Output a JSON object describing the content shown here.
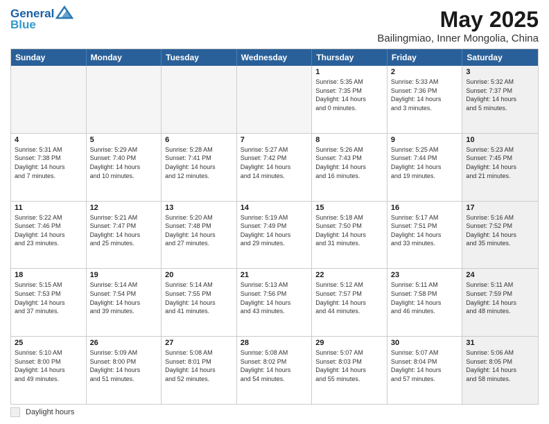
{
  "header": {
    "logo_general": "General",
    "logo_blue": "Blue",
    "title": "May 2025",
    "subtitle": "Bailingmiao, Inner Mongolia, China"
  },
  "calendar": {
    "days": [
      "Sunday",
      "Monday",
      "Tuesday",
      "Wednesday",
      "Thursday",
      "Friday",
      "Saturday"
    ],
    "rows": [
      [
        {
          "day": "",
          "empty": true
        },
        {
          "day": "",
          "empty": true
        },
        {
          "day": "",
          "empty": true
        },
        {
          "day": "",
          "empty": true
        },
        {
          "day": "1",
          "lines": [
            "Sunrise: 5:35 AM",
            "Sunset: 7:35 PM",
            "Daylight: 14 hours",
            "and 0 minutes."
          ]
        },
        {
          "day": "2",
          "lines": [
            "Sunrise: 5:33 AM",
            "Sunset: 7:36 PM",
            "Daylight: 14 hours",
            "and 3 minutes."
          ]
        },
        {
          "day": "3",
          "lines": [
            "Sunrise: 5:32 AM",
            "Sunset: 7:37 PM",
            "Daylight: 14 hours",
            "and 5 minutes."
          ],
          "shaded": true
        }
      ],
      [
        {
          "day": "4",
          "lines": [
            "Sunrise: 5:31 AM",
            "Sunset: 7:38 PM",
            "Daylight: 14 hours",
            "and 7 minutes."
          ]
        },
        {
          "day": "5",
          "lines": [
            "Sunrise: 5:29 AM",
            "Sunset: 7:40 PM",
            "Daylight: 14 hours",
            "and 10 minutes."
          ]
        },
        {
          "day": "6",
          "lines": [
            "Sunrise: 5:28 AM",
            "Sunset: 7:41 PM",
            "Daylight: 14 hours",
            "and 12 minutes."
          ]
        },
        {
          "day": "7",
          "lines": [
            "Sunrise: 5:27 AM",
            "Sunset: 7:42 PM",
            "Daylight: 14 hours",
            "and 14 minutes."
          ]
        },
        {
          "day": "8",
          "lines": [
            "Sunrise: 5:26 AM",
            "Sunset: 7:43 PM",
            "Daylight: 14 hours",
            "and 16 minutes."
          ]
        },
        {
          "day": "9",
          "lines": [
            "Sunrise: 5:25 AM",
            "Sunset: 7:44 PM",
            "Daylight: 14 hours",
            "and 19 minutes."
          ]
        },
        {
          "day": "10",
          "lines": [
            "Sunrise: 5:23 AM",
            "Sunset: 7:45 PM",
            "Daylight: 14 hours",
            "and 21 minutes."
          ],
          "shaded": true
        }
      ],
      [
        {
          "day": "11",
          "lines": [
            "Sunrise: 5:22 AM",
            "Sunset: 7:46 PM",
            "Daylight: 14 hours",
            "and 23 minutes."
          ]
        },
        {
          "day": "12",
          "lines": [
            "Sunrise: 5:21 AM",
            "Sunset: 7:47 PM",
            "Daylight: 14 hours",
            "and 25 minutes."
          ]
        },
        {
          "day": "13",
          "lines": [
            "Sunrise: 5:20 AM",
            "Sunset: 7:48 PM",
            "Daylight: 14 hours",
            "and 27 minutes."
          ]
        },
        {
          "day": "14",
          "lines": [
            "Sunrise: 5:19 AM",
            "Sunset: 7:49 PM",
            "Daylight: 14 hours",
            "and 29 minutes."
          ]
        },
        {
          "day": "15",
          "lines": [
            "Sunrise: 5:18 AM",
            "Sunset: 7:50 PM",
            "Daylight: 14 hours",
            "and 31 minutes."
          ]
        },
        {
          "day": "16",
          "lines": [
            "Sunrise: 5:17 AM",
            "Sunset: 7:51 PM",
            "Daylight: 14 hours",
            "and 33 minutes."
          ]
        },
        {
          "day": "17",
          "lines": [
            "Sunrise: 5:16 AM",
            "Sunset: 7:52 PM",
            "Daylight: 14 hours",
            "and 35 minutes."
          ],
          "shaded": true
        }
      ],
      [
        {
          "day": "18",
          "lines": [
            "Sunrise: 5:15 AM",
            "Sunset: 7:53 PM",
            "Daylight: 14 hours",
            "and 37 minutes."
          ]
        },
        {
          "day": "19",
          "lines": [
            "Sunrise: 5:14 AM",
            "Sunset: 7:54 PM",
            "Daylight: 14 hours",
            "and 39 minutes."
          ]
        },
        {
          "day": "20",
          "lines": [
            "Sunrise: 5:14 AM",
            "Sunset: 7:55 PM",
            "Daylight: 14 hours",
            "and 41 minutes."
          ]
        },
        {
          "day": "21",
          "lines": [
            "Sunrise: 5:13 AM",
            "Sunset: 7:56 PM",
            "Daylight: 14 hours",
            "and 43 minutes."
          ]
        },
        {
          "day": "22",
          "lines": [
            "Sunrise: 5:12 AM",
            "Sunset: 7:57 PM",
            "Daylight: 14 hours",
            "and 44 minutes."
          ]
        },
        {
          "day": "23",
          "lines": [
            "Sunrise: 5:11 AM",
            "Sunset: 7:58 PM",
            "Daylight: 14 hours",
            "and 46 minutes."
          ]
        },
        {
          "day": "24",
          "lines": [
            "Sunrise: 5:11 AM",
            "Sunset: 7:59 PM",
            "Daylight: 14 hours",
            "and 48 minutes."
          ],
          "shaded": true
        }
      ],
      [
        {
          "day": "25",
          "lines": [
            "Sunrise: 5:10 AM",
            "Sunset: 8:00 PM",
            "Daylight: 14 hours",
            "and 49 minutes."
          ]
        },
        {
          "day": "26",
          "lines": [
            "Sunrise: 5:09 AM",
            "Sunset: 8:00 PM",
            "Daylight: 14 hours",
            "and 51 minutes."
          ]
        },
        {
          "day": "27",
          "lines": [
            "Sunrise: 5:08 AM",
            "Sunset: 8:01 PM",
            "Daylight: 14 hours",
            "and 52 minutes."
          ]
        },
        {
          "day": "28",
          "lines": [
            "Sunrise: 5:08 AM",
            "Sunset: 8:02 PM",
            "Daylight: 14 hours",
            "and 54 minutes."
          ]
        },
        {
          "day": "29",
          "lines": [
            "Sunrise: 5:07 AM",
            "Sunset: 8:03 PM",
            "Daylight: 14 hours",
            "and 55 minutes."
          ]
        },
        {
          "day": "30",
          "lines": [
            "Sunrise: 5:07 AM",
            "Sunset: 8:04 PM",
            "Daylight: 14 hours",
            "and 57 minutes."
          ]
        },
        {
          "day": "31",
          "lines": [
            "Sunrise: 5:06 AM",
            "Sunset: 8:05 PM",
            "Daylight: 14 hours",
            "and 58 minutes."
          ],
          "shaded": true
        }
      ]
    ]
  },
  "legend": {
    "box_label": "Daylight hours"
  }
}
